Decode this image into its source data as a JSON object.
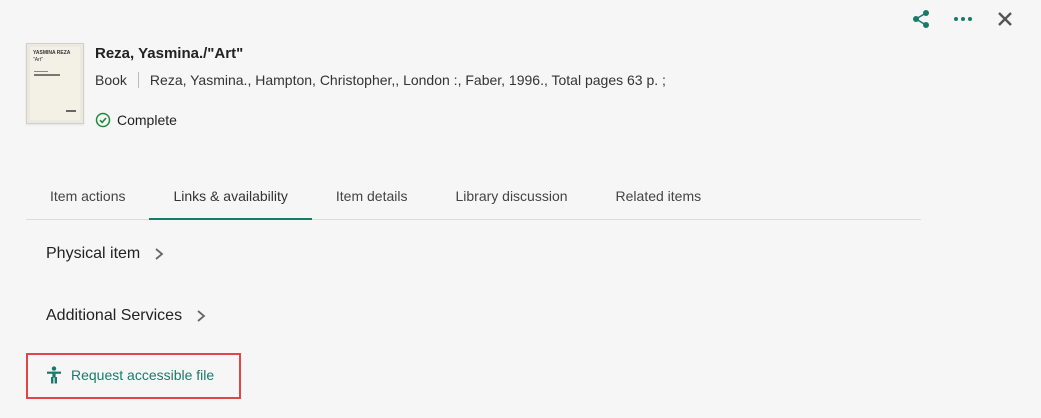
{
  "header_actions": {
    "share": "share-icon",
    "more": "more-icon",
    "close": "close-icon"
  },
  "record": {
    "cover_text_top": "YASMINA REZA",
    "cover_text_sub": "\"Art\"",
    "title": "Reza, Yasmina./\"Art\"",
    "type": "Book",
    "details": "Reza, Yasmina., Hampton, Christopher,, London :, Faber, 1996., Total pages 63 p. ;",
    "status": "Complete"
  },
  "tabs": [
    {
      "label": "Item actions"
    },
    {
      "label": "Links & availability"
    },
    {
      "label": "Item details"
    },
    {
      "label": "Library discussion"
    },
    {
      "label": "Related items"
    }
  ],
  "sections": {
    "physical": "Physical item",
    "additional": "Additional Services"
  },
  "request_link": "Request accessible file",
  "colors": {
    "accent": "#1a7a6a",
    "highlight": "#e0454a",
    "status_ok": "#1f8a3a"
  }
}
